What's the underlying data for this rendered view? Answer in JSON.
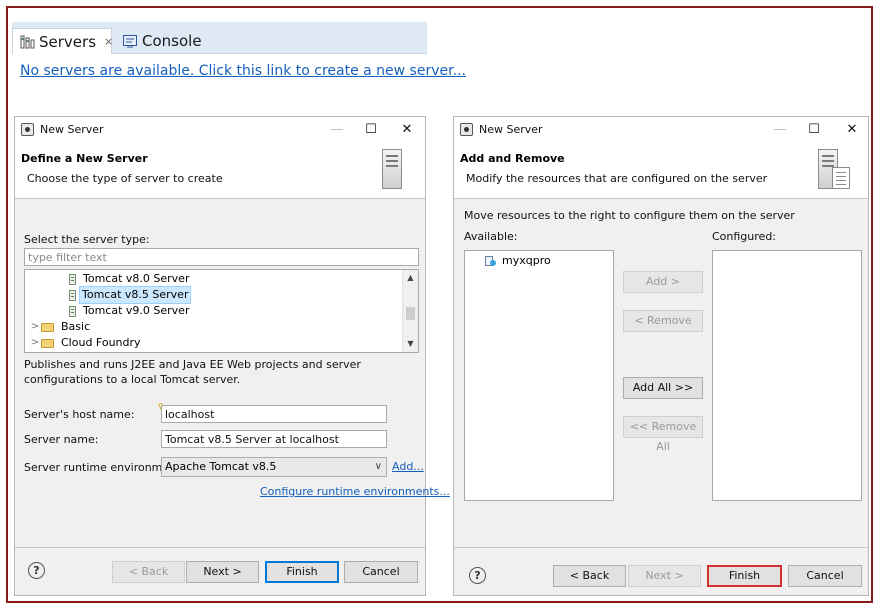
{
  "servers_view": {
    "tabs": [
      {
        "label": "Servers",
        "icon": "servers-icon",
        "close": "⨯"
      },
      {
        "label": "Console",
        "icon": "console-icon"
      }
    ],
    "new_server_link": "No servers are available. Click this link to create a new server..."
  },
  "new_server_dialog": {
    "title": "New Server",
    "window_buttons": {
      "minimize": "—",
      "maximize": "☐",
      "close": "✕"
    },
    "heading": "Define a New Server",
    "description": "Choose the type of server to create",
    "select_type_label": "Select the server type:",
    "filter_placeholder": "type filter text",
    "tree_items": [
      {
        "label": "Tomcat v8.0 Server",
        "kind": "server",
        "selected": false
      },
      {
        "label": "Tomcat v8.5 Server",
        "kind": "server",
        "selected": true
      },
      {
        "label": "Tomcat v9.0 Server",
        "kind": "server",
        "selected": false
      },
      {
        "label": "Basic",
        "kind": "folder",
        "selected": false
      },
      {
        "label": "Cloud Foundry",
        "kind": "folder",
        "selected": false
      }
    ],
    "server_description": "Publishes and runs J2EE and Java EE Web projects and server configurations to a local Tomcat server.",
    "host_label": "Server's host name:",
    "host_value": "localhost",
    "name_label": "Server name:",
    "name_value": "Tomcat v8.5 Server at localhost",
    "runtime_label": "Server runtime environment:",
    "runtime_value": "Apache Tomcat v8.5",
    "add_link": "Add...",
    "configure_link": "Configure runtime environments...",
    "buttons": {
      "help": "?",
      "back": "< Back",
      "next": "Next >",
      "finish": "Finish",
      "cancel": "Cancel"
    }
  },
  "add_remove_dialog": {
    "title": "New Server",
    "window_buttons": {
      "minimize": "—",
      "maximize": "☐",
      "close": "✕"
    },
    "heading": "Add and Remove",
    "description": "Modify the resources that are configured on the server",
    "instruction": "Move resources to the right to configure them on the server",
    "available_label": "Available:",
    "configured_label": "Configured:",
    "available_items": [
      "myxqpro"
    ],
    "configured_items": [],
    "move_buttons": {
      "add": "Add >",
      "remove": "< Remove",
      "add_all": "Add All >>",
      "remove_all": "<< Remove All"
    },
    "buttons": {
      "help": "?",
      "back": "< Back",
      "next": "Next >",
      "finish": "Finish",
      "cancel": "Cancel"
    }
  }
}
